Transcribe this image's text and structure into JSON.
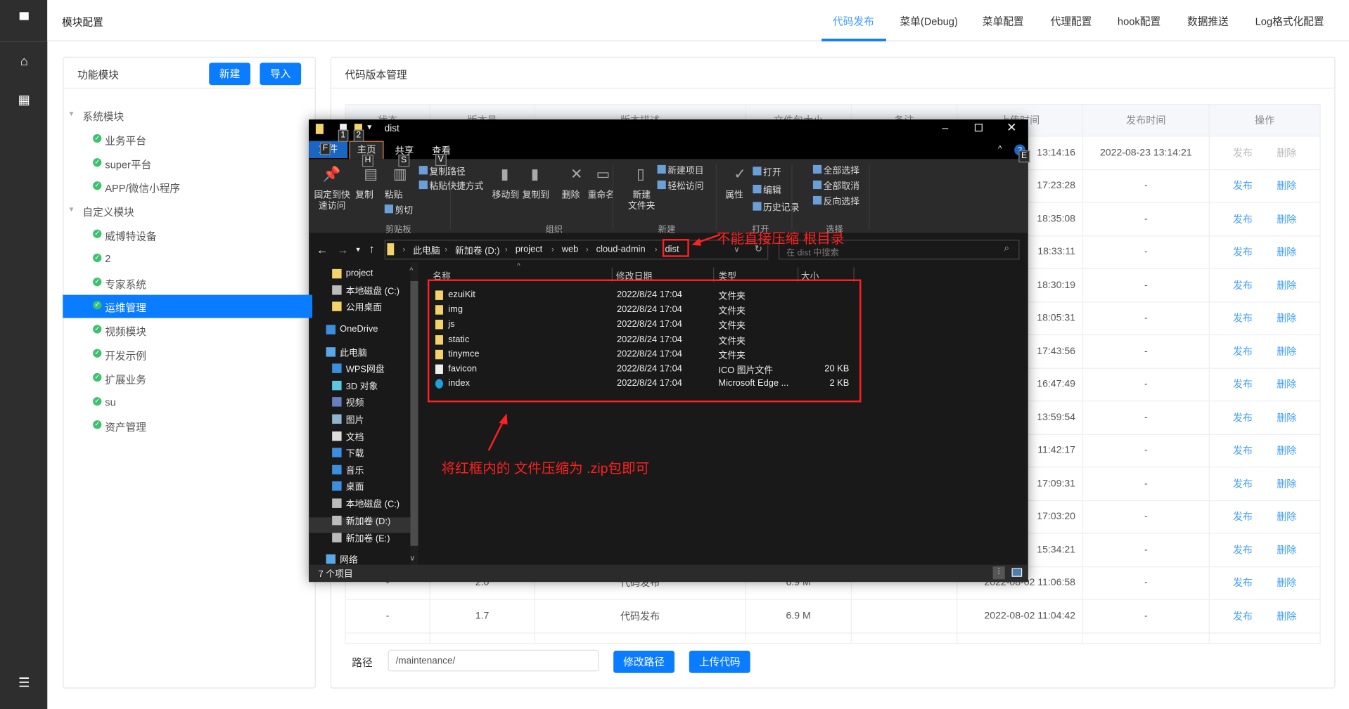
{
  "sidebar": {
    "icons": [
      "monitor-icon",
      "home-icon",
      "grid-icon",
      "sliders-icon"
    ]
  },
  "header": {
    "title": "模块配置",
    "tabs": [
      "代码发布",
      "菜单(Debug)",
      "菜单配置",
      "代理配置",
      "hook配置",
      "数据推送",
      "Log格式化配置"
    ],
    "active_tab": 0
  },
  "colors": {
    "accent": "#0a7cff",
    "link": "#409eff",
    "success": "#3ac26e",
    "annotation": "#ff2020"
  },
  "module_panel": {
    "title": "功能模块",
    "new_label": "新建",
    "import_label": "导入",
    "groups": [
      {
        "label": "系统模块",
        "items": [
          "业务平台",
          "super平台",
          "APP/微信小程序"
        ]
      },
      {
        "label": "自定义模块",
        "items": [
          "威博特设备",
          "2",
          "专家系统",
          "运维管理",
          "视频模块",
          "开发示例",
          "扩展业务",
          "su",
          "资产管理"
        ]
      }
    ],
    "selected": "运维管理"
  },
  "code_panel": {
    "title": "代码版本管理",
    "columns": [
      "状态",
      "版本号",
      "版本描述",
      "文件包大小",
      "备注",
      "上传时间",
      "发布时间",
      "操作"
    ],
    "publish_label": "发布",
    "delete_label": "删除",
    "rows": [
      {
        "status": "",
        "version": "",
        "desc": "",
        "size": "",
        "note": "",
        "upload": "13:14:16",
        "publish": "2022-08-23 13:14:21",
        "disabled": true
      },
      {
        "status": "",
        "version": "",
        "desc": "",
        "size": "",
        "note": "",
        "upload": "17:23:28",
        "publish": "-"
      },
      {
        "status": "",
        "version": "",
        "desc": "",
        "size": "",
        "note": "",
        "upload": "18:35:08",
        "publish": "-"
      },
      {
        "status": "",
        "version": "",
        "desc": "",
        "size": "",
        "note": "",
        "upload": "18:33:11",
        "publish": "-"
      },
      {
        "status": "",
        "version": "",
        "desc": "",
        "size": "",
        "note": "",
        "upload": "18:30:19",
        "publish": "-"
      },
      {
        "status": "",
        "version": "",
        "desc": "",
        "size": "",
        "note": "",
        "upload": "18:05:31",
        "publish": "-"
      },
      {
        "status": "",
        "version": "",
        "desc": "",
        "size": "",
        "note": "",
        "upload": "17:43:56",
        "publish": "-"
      },
      {
        "status": "",
        "version": "",
        "desc": "",
        "size": "",
        "note": "",
        "upload": "16:47:49",
        "publish": "-"
      },
      {
        "status": "",
        "version": "",
        "desc": "",
        "size": "",
        "note": "",
        "upload": "13:59:54",
        "publish": "-"
      },
      {
        "status": "",
        "version": "",
        "desc": "",
        "size": "",
        "note": "",
        "upload": "11:42:17",
        "publish": "-"
      },
      {
        "status": "",
        "version": "",
        "desc": "",
        "size": "",
        "note": "",
        "upload": "17:09:31",
        "publish": "-"
      },
      {
        "status": "",
        "version": "",
        "desc": "",
        "size": "",
        "note": "",
        "upload": "17:03:20",
        "publish": "-"
      },
      {
        "status": "",
        "version": "",
        "desc": "",
        "size": "",
        "note": "",
        "upload": "15:34:21",
        "publish": "-"
      },
      {
        "status": "-",
        "version": "2.0",
        "desc": "代码发布",
        "size": "6.9 M",
        "note": "",
        "upload": "2022-08-02 11:06:58",
        "publish": "-"
      },
      {
        "status": "-",
        "version": "1.7",
        "desc": "代码发布",
        "size": "6.9 M",
        "note": "",
        "upload": "2022-08-02 11:04:42",
        "publish": "-"
      }
    ],
    "path_label": "路径",
    "path_value": "/maintenance/",
    "modify_label": "修改路径",
    "upload_label": "上传代码"
  },
  "explorer": {
    "title": "dist",
    "ribbon_tabs": [
      "文件",
      "主页",
      "共享",
      "查看"
    ],
    "key_tips": [
      "1",
      "2",
      "F",
      "H",
      "S",
      "V",
      "E"
    ],
    "ribbon": {
      "pin": "固定到快\n速访问",
      "copy": "复制",
      "paste": "粘贴",
      "copy_path": "复制路径",
      "paste_shortcut": "粘贴快捷方式",
      "cut": "剪切",
      "move_to": "移动到",
      "copy_to": "复制到",
      "delete": "删除",
      "rename": "重命名",
      "new_folder": "新建\n文件夹",
      "new_item": "新建项目",
      "easy_access": "轻松访问",
      "properties": "属性",
      "open": "打开",
      "edit": "编辑",
      "history": "历史记录",
      "select_all": "全部选择",
      "select_none": "全部取消",
      "invert": "反向选择",
      "groups": [
        "剪贴板",
        "组织",
        "新建",
        "打开",
        "选择"
      ]
    },
    "breadcrumb": [
      "此电脑",
      "新加卷 (D:)",
      "project",
      "web",
      "cloud-admin",
      "dist"
    ],
    "search_placeholder": "在 dist 中搜索",
    "nav": [
      {
        "label": "project",
        "icon": "folder-icon"
      },
      {
        "label": "本地磁盘 (C:)",
        "icon": "drive-icon"
      },
      {
        "label": "公用桌面",
        "icon": "folder-icon"
      },
      {
        "label": "OneDrive",
        "icon": "cloud-icon"
      },
      {
        "label": "此电脑",
        "icon": "computer-icon"
      },
      {
        "label": "WPS网盘",
        "icon": "cloud-icon"
      },
      {
        "label": "3D 对象",
        "icon": "cube-icon"
      },
      {
        "label": "视频",
        "icon": "video-icon"
      },
      {
        "label": "图片",
        "icon": "picture-icon"
      },
      {
        "label": "文档",
        "icon": "document-icon"
      },
      {
        "label": "下载",
        "icon": "download-icon"
      },
      {
        "label": "音乐",
        "icon": "music-icon"
      },
      {
        "label": "桌面",
        "icon": "desktop-icon"
      },
      {
        "label": "本地磁盘 (C:)",
        "icon": "drive-icon"
      },
      {
        "label": "新加卷 (D:)",
        "icon": "drive-icon"
      },
      {
        "label": "新加卷 (E:)",
        "icon": "drive-icon"
      },
      {
        "label": "网络",
        "icon": "network-icon"
      }
    ],
    "columns": [
      "名称",
      "修改日期",
      "类型",
      "大小"
    ],
    "files": [
      {
        "name": "ezuiKit",
        "date": "2022/8/24 17:04",
        "type": "文件夹",
        "size": "",
        "icon": "folder-icon"
      },
      {
        "name": "img",
        "date": "2022/8/24 17:04",
        "type": "文件夹",
        "size": "",
        "icon": "folder-icon"
      },
      {
        "name": "js",
        "date": "2022/8/24 17:04",
        "type": "文件夹",
        "size": "",
        "icon": "folder-icon"
      },
      {
        "name": "static",
        "date": "2022/8/24 17:04",
        "type": "文件夹",
        "size": "",
        "icon": "folder-icon"
      },
      {
        "name": "tinymce",
        "date": "2022/8/24 17:04",
        "type": "文件夹",
        "size": "",
        "icon": "folder-icon"
      },
      {
        "name": "favicon",
        "date": "2022/8/24 17:04",
        "type": "ICO 图片文件",
        "size": "20 KB",
        "icon": "file-icon"
      },
      {
        "name": "index",
        "date": "2022/8/24 17:04",
        "type": "Microsoft Edge ...",
        "size": "2 KB",
        "icon": "edge-icon"
      }
    ],
    "status": "7 个项目"
  },
  "annotations": {
    "root_note": "不能直接压缩 根目录",
    "files_note": "将红框内的 文件压缩为 .zip包即可"
  }
}
